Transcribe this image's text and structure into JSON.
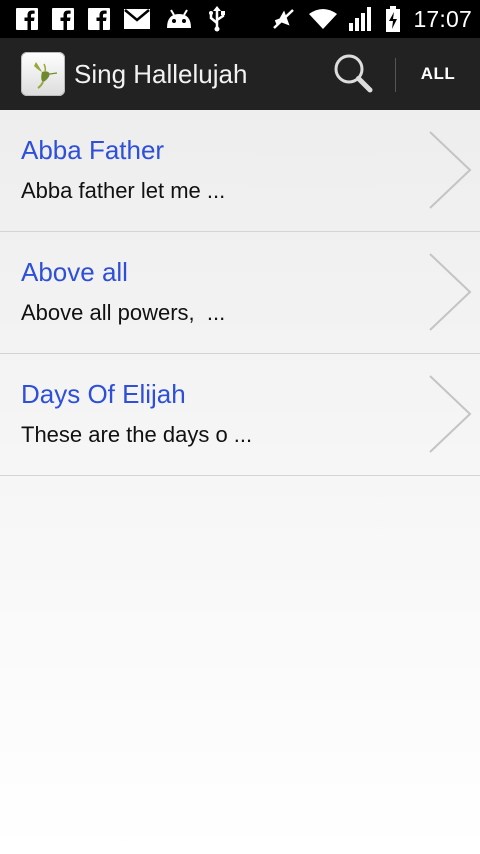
{
  "status_bar": {
    "time": "17:07",
    "icons": [
      "facebook-icon",
      "facebook-icon",
      "facebook-icon",
      "mail-icon",
      "android-icon",
      "usb-icon",
      "mute-icon",
      "wifi-icon",
      "signal-icon",
      "battery-charging-icon"
    ]
  },
  "action_bar": {
    "app_icon": "hummingbird-icon",
    "title": "Sing Hallelujah",
    "search_icon": "search-icon",
    "filter_label": "ALL"
  },
  "songs": [
    {
      "title": "Abba Father",
      "preview": "Abba father let me ..."
    },
    {
      "title": "Above all",
      "preview": "Above all powers,  ..."
    },
    {
      "title": "Days Of Elijah",
      "preview": "These are the days o ..."
    }
  ],
  "colors": {
    "title_blue": "#2e4fd8",
    "action_bar": "#222222",
    "status_bar": "#000000"
  }
}
